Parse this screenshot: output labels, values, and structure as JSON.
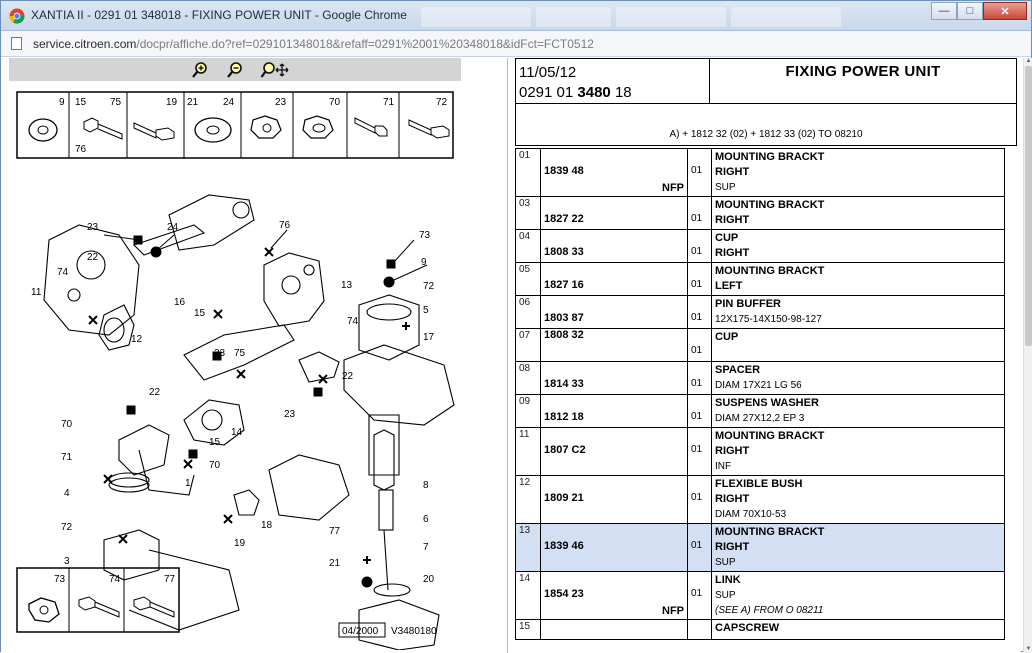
{
  "window": {
    "title": "XANTIA II - 0291 01 348018 - FIXING POWER UNIT - Google Chrome",
    "url_host": "service.citroen.com",
    "url_path": "/docpr/affiche.do?ref=029101348018&refaff=0291%2001%20348018&idFct=FCT0512"
  },
  "toolbar": {
    "zoom_in": "zoom-in",
    "zoom_out": "zoom-out",
    "zoom_pan": "zoom-pan"
  },
  "diagram": {
    "top_labels": [
      "9",
      "15",
      "75",
      "19",
      "21",
      "24",
      "23",
      "70",
      "71",
      "72"
    ],
    "bottom_labels": [
      "73",
      "74",
      "77"
    ],
    "footer_date": "04/2000",
    "footer_ref": "V3480180",
    "callouts": [
      "23",
      "24",
      "76",
      "22",
      "16",
      "15",
      "74",
      "11",
      "12",
      "13",
      "73",
      "9",
      "72",
      "5",
      "17",
      "75",
      "23",
      "22",
      "14",
      "23",
      "70",
      "15",
      "70",
      "71",
      "4",
      "72",
      "3",
      "1",
      "18",
      "19",
      "8",
      "6",
      "77",
      "21",
      "7",
      "20",
      "74",
      "22",
      "76",
      "15",
      "24"
    ]
  },
  "header": {
    "date": "11/05/12",
    "ref_prefix": "0291 01",
    "ref_bold": "3480",
    "ref_suffix": "18",
    "title": "FIXING POWER UNIT",
    "applicability": "A) + 1812 32 (02) + 1812 33 (02) TO 08210"
  },
  "parts": [
    {
      "pos": "01",
      "ref": "1839 48",
      "nfp": "NFP",
      "qty": "01",
      "d1": "MOUNTING BRACKT",
      "d2": "RIGHT",
      "d3": "SUP"
    },
    {
      "pos": "03",
      "ref": "1827 22",
      "nfp": "",
      "qty": "01",
      "d1": "MOUNTING BRACKT",
      "d2": "RIGHT",
      "d3": ""
    },
    {
      "pos": "04",
      "ref": "1808 33",
      "nfp": "",
      "qty": "01",
      "d1": "CUP",
      "d2": "RIGHT",
      "d3": ""
    },
    {
      "pos": "05",
      "ref": "1827 16",
      "nfp": "",
      "qty": "01",
      "d1": "MOUNTING BRACKT",
      "d2": "LEFT",
      "d3": ""
    },
    {
      "pos": "06",
      "ref": "1803 87",
      "nfp": "",
      "qty": "01",
      "d1": "PIN BUFFER",
      "d2": "12X175-14X150-98-127",
      "d3": ""
    },
    {
      "pos": "07",
      "ref": "1808 32",
      "nfp": "",
      "qty": "01",
      "d1": "CUP",
      "d2": "",
      "d3": ""
    },
    {
      "pos": "08",
      "ref": "1814 33",
      "nfp": "",
      "qty": "01",
      "d1": "SPACER",
      "d2": "DIAM 17X21 LG 56",
      "d3": ""
    },
    {
      "pos": "09",
      "ref": "1812 18",
      "nfp": "",
      "qty": "01",
      "d1": "SUSPENS WASHER",
      "d2": "DIAM 27X12,2 EP 3",
      "d3": ""
    },
    {
      "pos": "11",
      "ref": "1807 C2",
      "nfp": "",
      "qty": "01",
      "d1": "MOUNTING BRACKT",
      "d2": "RIGHT",
      "d3": "INF"
    },
    {
      "pos": "12",
      "ref": "1809 21",
      "nfp": "",
      "qty": "01",
      "d1": "FLEXIBLE BUSH",
      "d2": "RIGHT",
      "d3": "DIAM 70X10-53"
    },
    {
      "pos": "13",
      "ref": "1839 46",
      "nfp": "",
      "qty": "01",
      "d1": "MOUNTING BRACKT",
      "d2": "RIGHT",
      "d3": "SUP",
      "selected": true
    },
    {
      "pos": "14",
      "ref": "1854 23",
      "nfp": "NFP",
      "qty": "01",
      "d1": "LINK",
      "d2": "SUP",
      "d3": "(SEE A) FROM O 08211"
    },
    {
      "pos": "15",
      "ref": "",
      "nfp": "",
      "qty": "",
      "d1": "CAPSCREW",
      "d2": "",
      "d3": ""
    }
  ]
}
